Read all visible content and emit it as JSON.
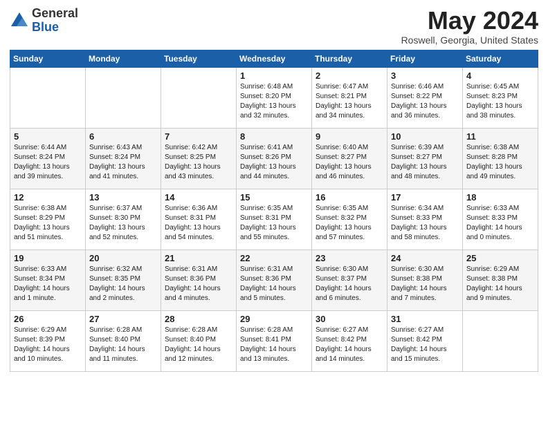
{
  "logo": {
    "general": "General",
    "blue": "Blue"
  },
  "title": "May 2024",
  "location": "Roswell, Georgia, United States",
  "days_of_week": [
    "Sunday",
    "Monday",
    "Tuesday",
    "Wednesday",
    "Thursday",
    "Friday",
    "Saturday"
  ],
  "weeks": [
    [
      {
        "day": "",
        "info": ""
      },
      {
        "day": "",
        "info": ""
      },
      {
        "day": "",
        "info": ""
      },
      {
        "day": "1",
        "info": "Sunrise: 6:48 AM\nSunset: 8:20 PM\nDaylight: 13 hours\nand 32 minutes."
      },
      {
        "day": "2",
        "info": "Sunrise: 6:47 AM\nSunset: 8:21 PM\nDaylight: 13 hours\nand 34 minutes."
      },
      {
        "day": "3",
        "info": "Sunrise: 6:46 AM\nSunset: 8:22 PM\nDaylight: 13 hours\nand 36 minutes."
      },
      {
        "day": "4",
        "info": "Sunrise: 6:45 AM\nSunset: 8:23 PM\nDaylight: 13 hours\nand 38 minutes."
      }
    ],
    [
      {
        "day": "5",
        "info": "Sunrise: 6:44 AM\nSunset: 8:24 PM\nDaylight: 13 hours\nand 39 minutes."
      },
      {
        "day": "6",
        "info": "Sunrise: 6:43 AM\nSunset: 8:24 PM\nDaylight: 13 hours\nand 41 minutes."
      },
      {
        "day": "7",
        "info": "Sunrise: 6:42 AM\nSunset: 8:25 PM\nDaylight: 13 hours\nand 43 minutes."
      },
      {
        "day": "8",
        "info": "Sunrise: 6:41 AM\nSunset: 8:26 PM\nDaylight: 13 hours\nand 44 minutes."
      },
      {
        "day": "9",
        "info": "Sunrise: 6:40 AM\nSunset: 8:27 PM\nDaylight: 13 hours\nand 46 minutes."
      },
      {
        "day": "10",
        "info": "Sunrise: 6:39 AM\nSunset: 8:27 PM\nDaylight: 13 hours\nand 48 minutes."
      },
      {
        "day": "11",
        "info": "Sunrise: 6:38 AM\nSunset: 8:28 PM\nDaylight: 13 hours\nand 49 minutes."
      }
    ],
    [
      {
        "day": "12",
        "info": "Sunrise: 6:38 AM\nSunset: 8:29 PM\nDaylight: 13 hours\nand 51 minutes."
      },
      {
        "day": "13",
        "info": "Sunrise: 6:37 AM\nSunset: 8:30 PM\nDaylight: 13 hours\nand 52 minutes."
      },
      {
        "day": "14",
        "info": "Sunrise: 6:36 AM\nSunset: 8:31 PM\nDaylight: 13 hours\nand 54 minutes."
      },
      {
        "day": "15",
        "info": "Sunrise: 6:35 AM\nSunset: 8:31 PM\nDaylight: 13 hours\nand 55 minutes."
      },
      {
        "day": "16",
        "info": "Sunrise: 6:35 AM\nSunset: 8:32 PM\nDaylight: 13 hours\nand 57 minutes."
      },
      {
        "day": "17",
        "info": "Sunrise: 6:34 AM\nSunset: 8:33 PM\nDaylight: 13 hours\nand 58 minutes."
      },
      {
        "day": "18",
        "info": "Sunrise: 6:33 AM\nSunset: 8:33 PM\nDaylight: 14 hours\nand 0 minutes."
      }
    ],
    [
      {
        "day": "19",
        "info": "Sunrise: 6:33 AM\nSunset: 8:34 PM\nDaylight: 14 hours\nand 1 minute."
      },
      {
        "day": "20",
        "info": "Sunrise: 6:32 AM\nSunset: 8:35 PM\nDaylight: 14 hours\nand 2 minutes."
      },
      {
        "day": "21",
        "info": "Sunrise: 6:31 AM\nSunset: 8:36 PM\nDaylight: 14 hours\nand 4 minutes."
      },
      {
        "day": "22",
        "info": "Sunrise: 6:31 AM\nSunset: 8:36 PM\nDaylight: 14 hours\nand 5 minutes."
      },
      {
        "day": "23",
        "info": "Sunrise: 6:30 AM\nSunset: 8:37 PM\nDaylight: 14 hours\nand 6 minutes."
      },
      {
        "day": "24",
        "info": "Sunrise: 6:30 AM\nSunset: 8:38 PM\nDaylight: 14 hours\nand 7 minutes."
      },
      {
        "day": "25",
        "info": "Sunrise: 6:29 AM\nSunset: 8:38 PM\nDaylight: 14 hours\nand 9 minutes."
      }
    ],
    [
      {
        "day": "26",
        "info": "Sunrise: 6:29 AM\nSunset: 8:39 PM\nDaylight: 14 hours\nand 10 minutes."
      },
      {
        "day": "27",
        "info": "Sunrise: 6:28 AM\nSunset: 8:40 PM\nDaylight: 14 hours\nand 11 minutes."
      },
      {
        "day": "28",
        "info": "Sunrise: 6:28 AM\nSunset: 8:40 PM\nDaylight: 14 hours\nand 12 minutes."
      },
      {
        "day": "29",
        "info": "Sunrise: 6:28 AM\nSunset: 8:41 PM\nDaylight: 14 hours\nand 13 minutes."
      },
      {
        "day": "30",
        "info": "Sunrise: 6:27 AM\nSunset: 8:42 PM\nDaylight: 14 hours\nand 14 minutes."
      },
      {
        "day": "31",
        "info": "Sunrise: 6:27 AM\nSunset: 8:42 PM\nDaylight: 14 hours\nand 15 minutes."
      },
      {
        "day": "",
        "info": ""
      }
    ]
  ]
}
